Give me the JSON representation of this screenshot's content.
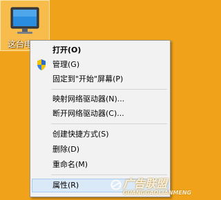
{
  "desktop": {
    "background_color": "#f0a21a",
    "icon": {
      "icon_name": "computer-icon",
      "label": "这台电"
    }
  },
  "context_menu": {
    "items": [
      {
        "label": "打开(O)",
        "bold": true
      },
      {
        "label": "管理(G)",
        "icon": "uac-shield-icon"
      },
      {
        "label": "固定到\"开始\"屏幕(P)"
      },
      {
        "separator": true
      },
      {
        "label": "映射网络驱动器(N)..."
      },
      {
        "label": "断开网络驱动器(C)..."
      },
      {
        "separator": true
      },
      {
        "label": "创建快捷方式(S)"
      },
      {
        "label": "删除(D)"
      },
      {
        "label": "重命名(M)"
      },
      {
        "separator": true
      },
      {
        "label": "属性(R)",
        "highlighted": true
      }
    ],
    "highlight_color": "#dae9f8"
  },
  "watermark": {
    "text": "广告联盟",
    "sub": "GUANGGAOLIANMENG"
  }
}
